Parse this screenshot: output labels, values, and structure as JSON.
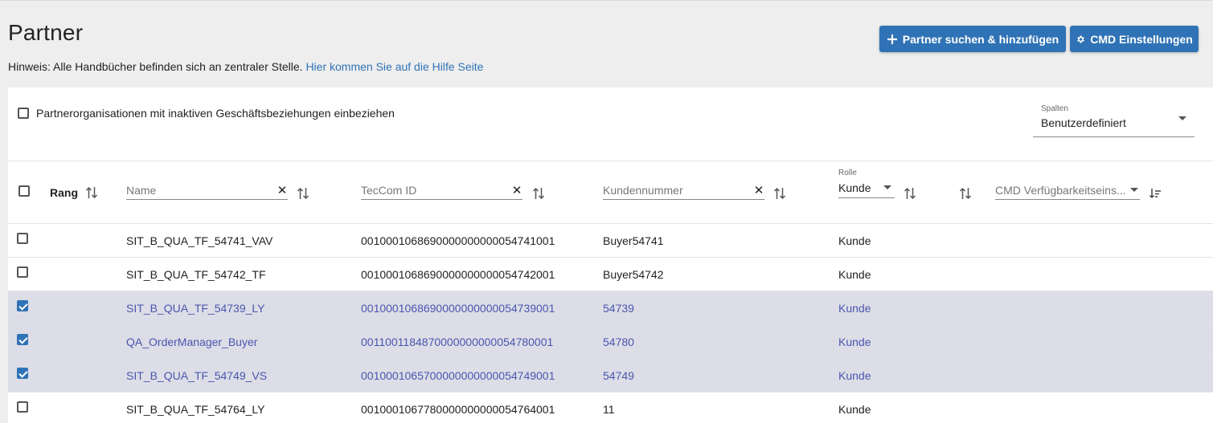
{
  "page": {
    "title": "Partner",
    "hint_text": "Hinweis: Alle Handbücher befinden sich an zentraler Stelle.",
    "hint_link": "Hier kommen Sie auf die Hilfe Seite"
  },
  "toolbar": {
    "add_label": "Partner suchen & hinzufügen",
    "cmd_label": "CMD Einstellungen",
    "accent_color": "#2f73b6"
  },
  "options": {
    "inactive_label": "Partnerorganisationen mit inaktiven Geschäftsbeziehungen einbeziehen",
    "inactive_checked": false
  },
  "columns_select": {
    "label": "Spalten",
    "value": "Benutzerdefiniert"
  },
  "table": {
    "headers": {
      "rank": "Rang",
      "name_placeholder": "Name",
      "teccom_placeholder": "TecCom ID",
      "customer_placeholder": "Kundennummer",
      "role_label": "Rolle",
      "role_value": "Kunde",
      "cmd_placeholder": "CMD Verfügbarkeitseins..."
    },
    "selected_row_color": "#dcdde6",
    "rows": [
      {
        "checked": false,
        "name": "SIT_B_QUA_TF_54741_VAV",
        "teccom": "0010001068690000000000054741001",
        "customer": "Buyer54741",
        "role": "Kunde"
      },
      {
        "checked": false,
        "name": "SIT_B_QUA_TF_54742_TF",
        "teccom": "0010001068690000000000054742001",
        "customer": "Buyer54742",
        "role": "Kunde"
      },
      {
        "checked": true,
        "name": "SIT_B_QUA_TF_54739_LY",
        "teccom": "0010001068690000000000054739001",
        "customer": "54739",
        "role": "Kunde"
      },
      {
        "checked": true,
        "name": "QA_OrderManager_Buyer",
        "teccom": "0011001184870000000000054780001",
        "customer": "54780",
        "role": "Kunde"
      },
      {
        "checked": true,
        "name": "SIT_B_QUA_TF_54749_VS",
        "teccom": "0010001065700000000000054749001",
        "customer": "54749",
        "role": "Kunde"
      },
      {
        "checked": false,
        "name": "SIT_B_QUA_TF_54764_LY",
        "teccom": "0010001067780000000000054764001",
        "customer": "11",
        "role": "Kunde"
      }
    ]
  }
}
